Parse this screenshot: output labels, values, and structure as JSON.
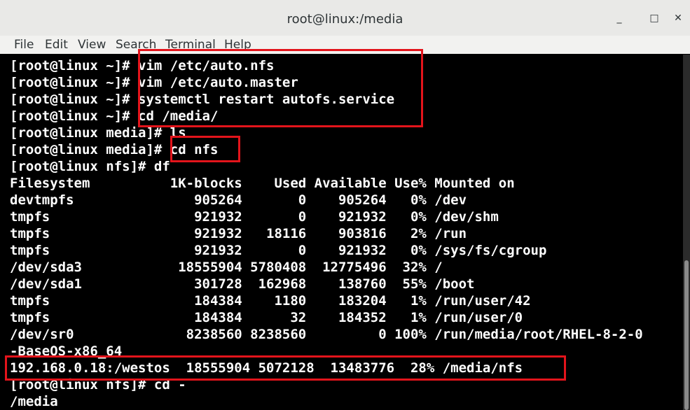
{
  "window": {
    "title": "root@linux:/media",
    "minimize": "_",
    "maximize": "□",
    "close": "✕"
  },
  "menu": [
    "File",
    "Edit",
    "View",
    "Search",
    "Terminal",
    "Help"
  ],
  "terminal_lines": [
    "[root@linux ~]# vim /etc/auto.nfs",
    "[root@linux ~]# vim /etc/auto.master",
    "[root@linux ~]# systemctl restart autofs.service",
    "[root@linux ~]# cd /media/",
    "[root@linux media]# ls",
    "[root@linux media]# cd nfs",
    "[root@linux nfs]# df",
    "Filesystem          1K-blocks    Used Available Use% Mounted on",
    "devtmpfs               905264       0    905264   0% /dev",
    "tmpfs                  921932       0    921932   0% /dev/shm",
    "tmpfs                  921932   18116    903816   2% /run",
    "tmpfs                  921932       0    921932   0% /sys/fs/cgroup",
    "/dev/sda3            18555904 5780408  12775496  32% /",
    "/dev/sda1              301728  162968    138760  55% /boot",
    "tmpfs                  184384    1180    183204   1% /run/user/42",
    "tmpfs                  184384      32    184352   1% /run/user/0",
    "/dev/sr0              8238560 8238560         0 100% /run/media/root/RHEL-8-2-0",
    "-BaseOS-x86_64",
    "192.168.0.18:/westos  18555904 5072128  13483776  28% /media/nfs",
    "[root@linux nfs]# cd -",
    "/media"
  ],
  "colors": {
    "highlight": "#e3141b",
    "terminal_bg": "#000000",
    "terminal_fg": "#ffffff"
  }
}
